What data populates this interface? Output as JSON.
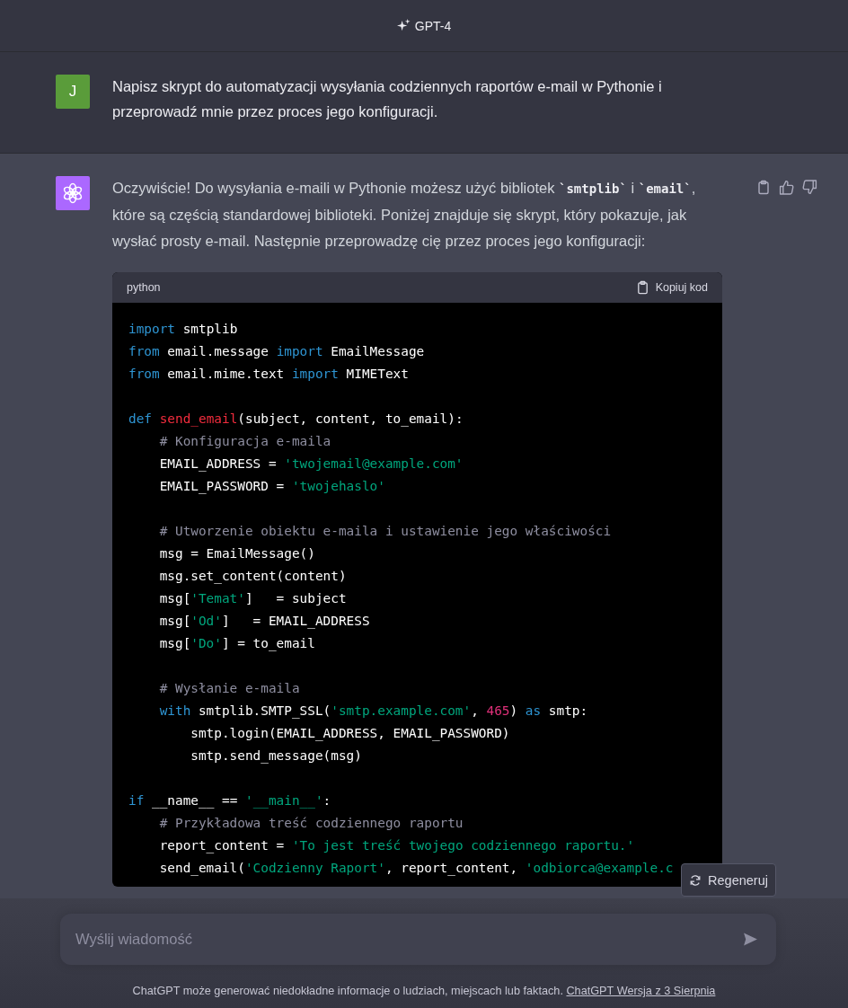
{
  "header": {
    "model": "GPT-4"
  },
  "user_message": {
    "avatar": "J",
    "text": "Napisz skrypt do automatyzacji wysyłania codziennych raportów e-mail w Pythonie i przeprowadź mnie przez proces jego konfiguracji."
  },
  "assistant_message": {
    "text": "Oczywiście! Do wysyłania e-maili w Pythonie możesz użyć bibliotek **`smtplib`** i **`email`**, które są częścią standardowej biblioteki. Poniżej znajduje się skrypt, który pokazuje, jak wysłać prosty e-mail. Następnie przeprowadzę cię przez proces jego konfiguracji:",
    "code_block": {
      "language": "python",
      "copy_label": "Kopiuj kod",
      "lines": [
        {
          "kind": "top",
          "tokens": [
            {
              "kind": "keyword",
              "text": "import"
            },
            {
              "kind": "plain",
              "text": " smtplib"
            }
          ]
        },
        {
          "kind": "top",
          "tokens": [
            {
              "kind": "keyword",
              "text": "from"
            },
            {
              "kind": "plain",
              "text": " email.message "
            },
            {
              "kind": "keyword",
              "text": "import"
            },
            {
              "kind": "plain",
              "text": " EmailMessage"
            }
          ]
        },
        {
          "kind": "top",
          "tokens": [
            {
              "kind": "keyword",
              "text": "from"
            },
            {
              "kind": "plain",
              "text": " email.mime.text "
            },
            {
              "kind": "keyword",
              "text": "import"
            },
            {
              "kind": "plain",
              "text": " MIMEText"
            }
          ]
        },
        {
          "kind": "blank"
        },
        {
          "kind": "top",
          "tokens": [
            {
              "kind": "keyword",
              "text": "def"
            },
            {
              "kind": "function",
              "text": " send_email"
            },
            {
              "kind": "plain",
              "text": "(subject, content, to_email):"
            }
          ]
        },
        {
          "kind": "body",
          "tokens": [
            {
              "kind": "comment",
              "text": "# Konfiguracja e-maila"
            }
          ]
        },
        {
          "kind": "body",
          "tokens": [
            {
              "kind": "plain",
              "text": "EMAIL_ADDRESS = "
            },
            {
              "kind": "string",
              "text": "'twojemail@example.com'"
            }
          ]
        },
        {
          "kind": "body",
          "tokens": [
            {
              "kind": "plain",
              "text": "EMAIL_PASSWORD = "
            },
            {
              "kind": "string",
              "text": "'twojehaslo'"
            }
          ]
        },
        {
          "kind": "blank"
        },
        {
          "kind": "body",
          "tokens": [
            {
              "kind": "comment",
              "text": "# Utworzenie obiektu e-maila i ustawienie jego właściwości"
            }
          ]
        },
        {
          "kind": "body",
          "tokens": [
            {
              "kind": "plain",
              "text": "msg = EmailMessage()"
            }
          ]
        },
        {
          "kind": "body",
          "tokens": [
            {
              "kind": "plain",
              "text": "msg.set_content(content)"
            }
          ]
        },
        {
          "kind": "body",
          "tokens": [
            {
              "kind": "plain",
              "text": "msg["
            },
            {
              "kind": "string",
              "text": "'Temat'"
            },
            {
              "kind": "plain",
              "text": "]   = subject"
            }
          ]
        },
        {
          "kind": "body",
          "tokens": [
            {
              "kind": "plain",
              "text": "msg["
            },
            {
              "kind": "string",
              "text": "'Od'"
            },
            {
              "kind": "plain",
              "text": "]   = EMAIL_ADDRESS"
            }
          ]
        },
        {
          "kind": "body",
          "tokens": [
            {
              "kind": "plain",
              "text": "msg["
            },
            {
              "kind": "string",
              "text": "'Do'"
            },
            {
              "kind": "plain",
              "text": "] = to_email"
            }
          ]
        },
        {
          "kind": "blank"
        },
        {
          "kind": "body",
          "tokens": [
            {
              "kind": "comment",
              "text": "# Wysłanie e-maila"
            }
          ]
        },
        {
          "kind": "body",
          "tokens": [
            {
              "kind": "keyword",
              "text": "with"
            },
            {
              "kind": "plain",
              "text": " smtplib.SMTP_SSL("
            },
            {
              "kind": "string",
              "text": "'smtp.example.com'"
            },
            {
              "kind": "plain",
              "text": ", "
            },
            {
              "kind": "number",
              "text": "465"
            },
            {
              "kind": "plain",
              "text": ") "
            },
            {
              "kind": "keyword",
              "text": "as"
            },
            {
              "kind": "plain",
              "text": " smtp:"
            }
          ]
        },
        {
          "kind": "nested",
          "tokens": [
            {
              "kind": "plain",
              "text": "smtp.login(EMAIL_ADDRESS, EMAIL_PASSWORD)"
            }
          ]
        },
        {
          "kind": "nested",
          "tokens": [
            {
              "kind": "plain",
              "text": "smtp.send_message(msg)"
            }
          ]
        },
        {
          "kind": "blank"
        },
        {
          "kind": "top",
          "tokens": [
            {
              "kind": "keyword",
              "text": "if"
            },
            {
              "kind": "plain",
              "text": " __name__ == "
            },
            {
              "kind": "string",
              "text": "'__main__'"
            },
            {
              "kind": "plain",
              "text": ":"
            }
          ]
        },
        {
          "kind": "body",
          "tokens": [
            {
              "kind": "comment",
              "text": "# Przykładowa treść codziennego raportu"
            }
          ]
        },
        {
          "kind": "body",
          "tokens": [
            {
              "kind": "plain",
              "text": "report_content = "
            },
            {
              "kind": "string",
              "text": "'To jest treść twojego codziennego raportu.'"
            }
          ]
        },
        {
          "kind": "body",
          "tokens": [
            {
              "kind": "plain",
              "text": "send_email("
            },
            {
              "kind": "string",
              "text": "'Codzienny Raport'"
            },
            {
              "kind": "plain",
              "text": ", report_content, "
            },
            {
              "kind": "string",
              "text": "'odbiorca@example.c"
            }
          ]
        }
      ]
    }
  },
  "regenerate_button": {
    "label": "Regeneruj"
  },
  "composer": {
    "placeholder": "Wyślij wiadomość"
  },
  "footer": {
    "text": "ChatGPT może generować niedokładne informacje o ludziach, miejscach lub faktach.",
    "link": "ChatGPT Wersja z 3 Sierpnia"
  }
}
